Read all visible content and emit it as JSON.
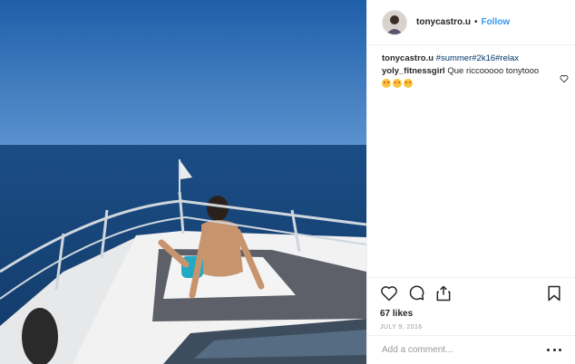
{
  "post": {
    "username": "tonycastro.u",
    "follow_label": "Follow",
    "dot": "•"
  },
  "caption": {
    "username": "tonycastro.u",
    "hashtags": "#summer#2k16#relax"
  },
  "comment": {
    "username": "yoly_fitnessgirl",
    "text": "Que riccooooo tonytooo",
    "emojis": [
      "smiling-face-with-heart-eyes",
      "smiling-face-with-heart-eyes",
      "smiling-face-with-heart-eyes"
    ]
  },
  "actions": {
    "icons": [
      "heart-icon",
      "comment-icon",
      "share-icon",
      "bookmark-icon"
    ]
  },
  "likes_label": "67 likes",
  "date": "JULY 9, 2016",
  "add_comment": {
    "placeholder": "Add a comment..."
  },
  "colors": {
    "link": "#3897f0",
    "hashtag": "#003569",
    "sea": "#1c4f86",
    "sky": "#2f75bf"
  }
}
